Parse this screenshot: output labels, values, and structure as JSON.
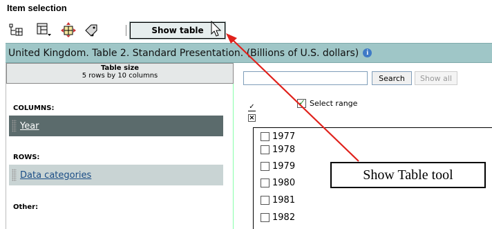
{
  "header": {
    "title": "Item selection"
  },
  "toolbar": {
    "icons": [
      "layout-icon",
      "table-layout-icon",
      "move-icon",
      "tag-icon"
    ],
    "show_table_label": "Show table"
  },
  "title_bar": {
    "text": "United Kingdom. Table 2. Standard Presentation. (Billions of U.S. dollars)",
    "info_icon": "i"
  },
  "table_size": {
    "label": "Table size",
    "value": "5 rows by 10 columns"
  },
  "columns": {
    "label": "COLUMNS:",
    "item": "Year"
  },
  "rows": {
    "label": "ROWS:",
    "item": "Data categories"
  },
  "other": {
    "label": "Other:"
  },
  "search": {
    "placeholder": "",
    "button": "Search",
    "show_all": "Show all"
  },
  "select_range": {
    "label": "Select range",
    "checked": true
  },
  "years": [
    "1977",
    "1978",
    "1979",
    "1980",
    "1981",
    "1982"
  ],
  "annotation": {
    "text": "Show Table tool",
    "arrow_color": "#e0211b"
  },
  "colors": {
    "title_bar": "#9fc6c7",
    "year_selected": "#5b6b6c",
    "dim_item": "#c9d4d4",
    "link": "#1a4d86"
  }
}
